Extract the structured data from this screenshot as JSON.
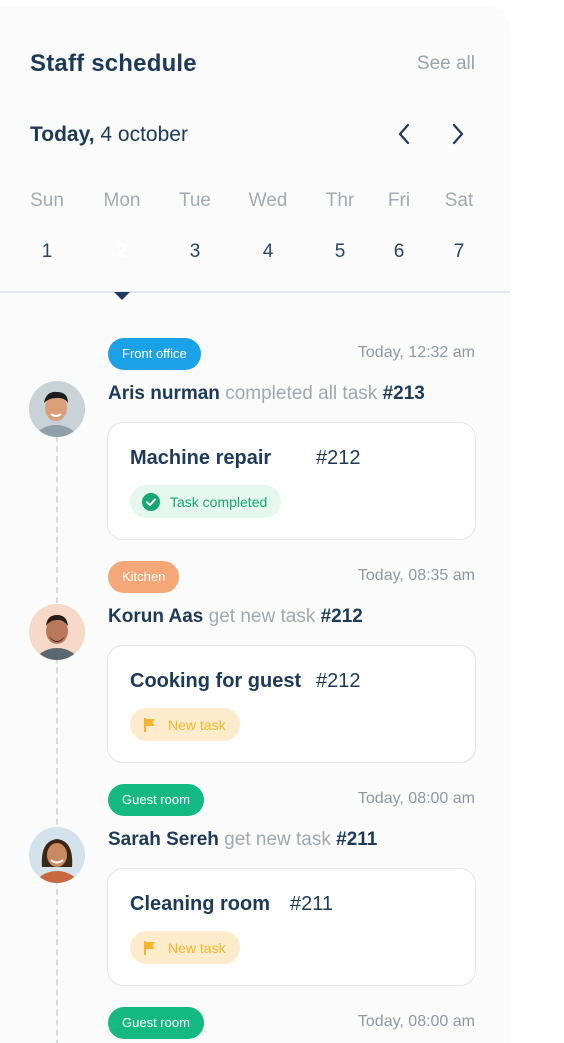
{
  "header": {
    "title": "Staff schedule",
    "see_all": "See all"
  },
  "date": {
    "today_label": "Today,",
    "date_text": " 4 october"
  },
  "weekdays": [
    "Sun",
    "Mon",
    "Tue",
    "Wed",
    "Thr",
    "Fri",
    "Sat"
  ],
  "days": [
    "1",
    "2",
    "3",
    "4",
    "5",
    "6",
    "7"
  ],
  "selected_day": "2",
  "entries": [
    {
      "tag": "Front office",
      "time": "Today, 12:32 am",
      "who": "Aris nurman",
      "action": " completed all task ",
      "ref": "#213",
      "task_title": "Machine repair",
      "task_number": "#212",
      "status": "Task completed"
    },
    {
      "tag": "Kitchen",
      "time": "Today, 08:35 am",
      "who": "Korun Aas",
      "action": " get new task ",
      "ref": "#212",
      "task_title": "Cooking for guest",
      "task_number": "#212",
      "status": "New task"
    },
    {
      "tag": "Guest room",
      "time": "Today, 08:00 am",
      "who": "Sarah Sereh",
      "action": " get new task ",
      "ref": "#211",
      "task_title": "Cleaning room",
      "task_number": "#211",
      "status": "New task"
    },
    {
      "tag": "Guest room",
      "time": "Today, 08:00 am"
    }
  ],
  "colors": {
    "navy": "#1d3a57",
    "front_office": "#1ba1e8",
    "kitchen": "#f6a777",
    "guest_room": "#13b981",
    "completed": "#17a673",
    "new_task": "#f4b52e"
  }
}
